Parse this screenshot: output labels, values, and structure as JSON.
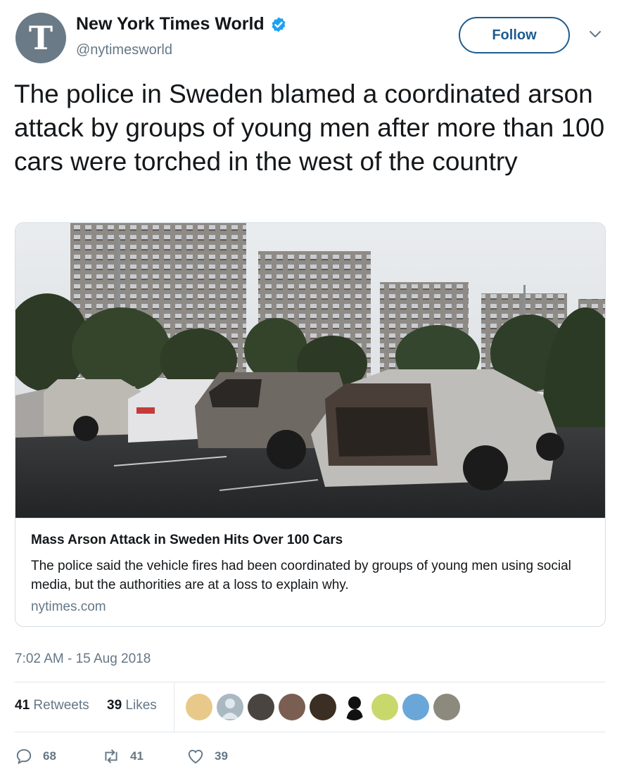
{
  "tweet": {
    "author": {
      "display_name": "New York Times World",
      "handle": "@nytimesworld",
      "avatar_glyph": "T",
      "verified_icon": "verified-badge-icon"
    },
    "follow_label": "Follow",
    "text": "The police in Sweden blamed a coordinated arson attack by groups of young men after more than 100 cars were torched in the west of the country",
    "card": {
      "title": "Mass Arson Attack in Sweden Hits Over 100 Cars",
      "description": "The police said the vehicle fires had been coordinated by groups of young men using social media, but the authorities are at a loss to explain why.",
      "domain": "nytimes.com"
    },
    "timestamp": "7:02 AM - 15 Aug 2018",
    "stats": {
      "retweets_count": "41",
      "retweets_label": "Retweets",
      "likes_count": "39",
      "likes_label": "Likes"
    },
    "actions": {
      "reply_count": "68",
      "retweet_count": "41",
      "like_count": "39"
    }
  },
  "colors": {
    "link_blue": "#1d5b8f",
    "verified_blue": "#1da1f2",
    "secondary_text": "#657786",
    "border": "#e1e8ed"
  }
}
